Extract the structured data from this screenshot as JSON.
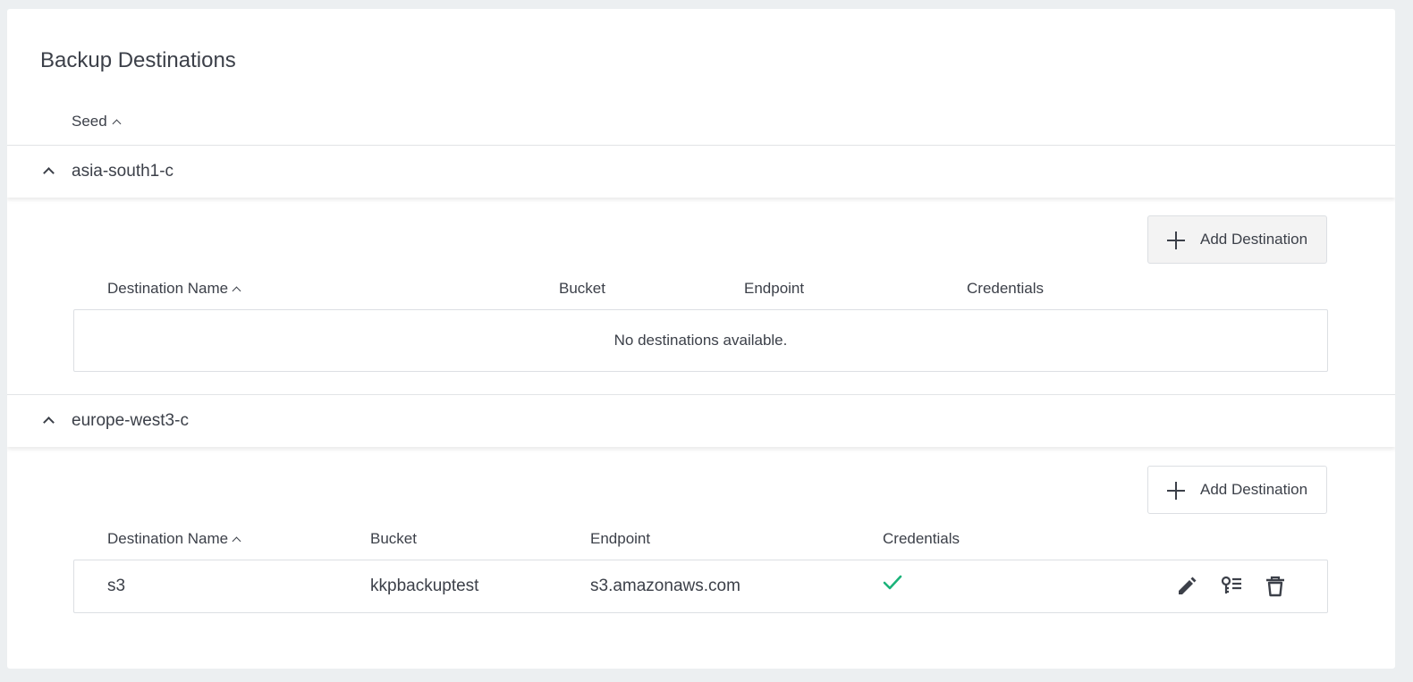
{
  "page": {
    "title": "Backup Destinations",
    "seed_column_label": "Seed"
  },
  "colors": {
    "background": "#eceff1",
    "card": "#ffffff",
    "text": "#3c4049",
    "success": "#1bb37a",
    "button_hover_bg": "#f3f3f3"
  },
  "seeds": [
    {
      "name": "asia-south1-c",
      "expanded": true,
      "add_button_label": "Add Destination",
      "columns": [
        "Destination Name",
        "Bucket",
        "Endpoint",
        "Credentials"
      ],
      "empty_message": "No destinations available.",
      "rows": []
    },
    {
      "name": "europe-west3-c",
      "expanded": true,
      "add_button_label": "Add Destination",
      "columns": [
        "Destination Name",
        "Bucket",
        "Endpoint",
        "Credentials"
      ],
      "rows": [
        {
          "destination_name": "s3",
          "bucket": "kkpbackuptest",
          "endpoint": "s3.amazonaws.com",
          "credentials_icon": "check-icon",
          "actions": [
            "edit-icon",
            "edit-credentials-icon",
            "delete-icon"
          ]
        }
      ]
    }
  ]
}
